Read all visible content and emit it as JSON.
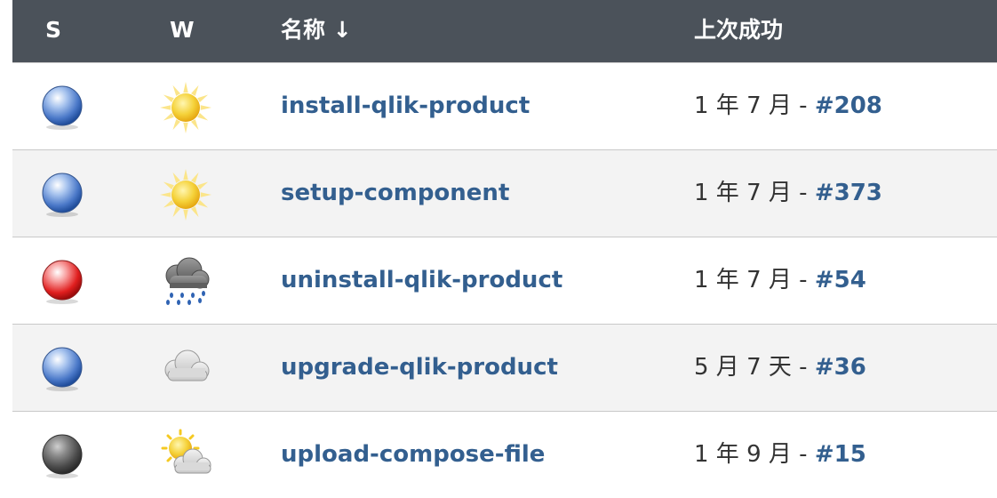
{
  "header": {
    "s": "S",
    "w": "W",
    "name": "名称 ↓",
    "last_success": "上次成功"
  },
  "rows": [
    {
      "status": "blue",
      "weather": "sunny",
      "name": "install-qlik-product",
      "time": "1 年 7 月",
      "sep": "-",
      "build": "#208"
    },
    {
      "status": "blue",
      "weather": "sunny",
      "name": "setup-component",
      "time": "1 年 7 月",
      "sep": "-",
      "build": "#373"
    },
    {
      "status": "red",
      "weather": "storm",
      "name": "uninstall-qlik-product",
      "time": "1 年 7 月",
      "sep": "-",
      "build": "#54"
    },
    {
      "status": "blue",
      "weather": "cloudy",
      "name": "upgrade-qlik-product",
      "time": "5 月 7 天",
      "sep": "-",
      "build": "#36"
    },
    {
      "status": "grey",
      "weather": "partly-cloudy",
      "name": "upload-compose-file",
      "time": "1 年 9 月",
      "sep": "-",
      "build": "#15"
    }
  ],
  "colors": {
    "header_bg": "#4b525a",
    "link": "#335f8f",
    "alt_row": "#f3f3f3",
    "blue_ball": "#4a78c8",
    "red_ball": "#e01e1e",
    "grey_ball": "#555555",
    "sun": "#f5c921"
  }
}
